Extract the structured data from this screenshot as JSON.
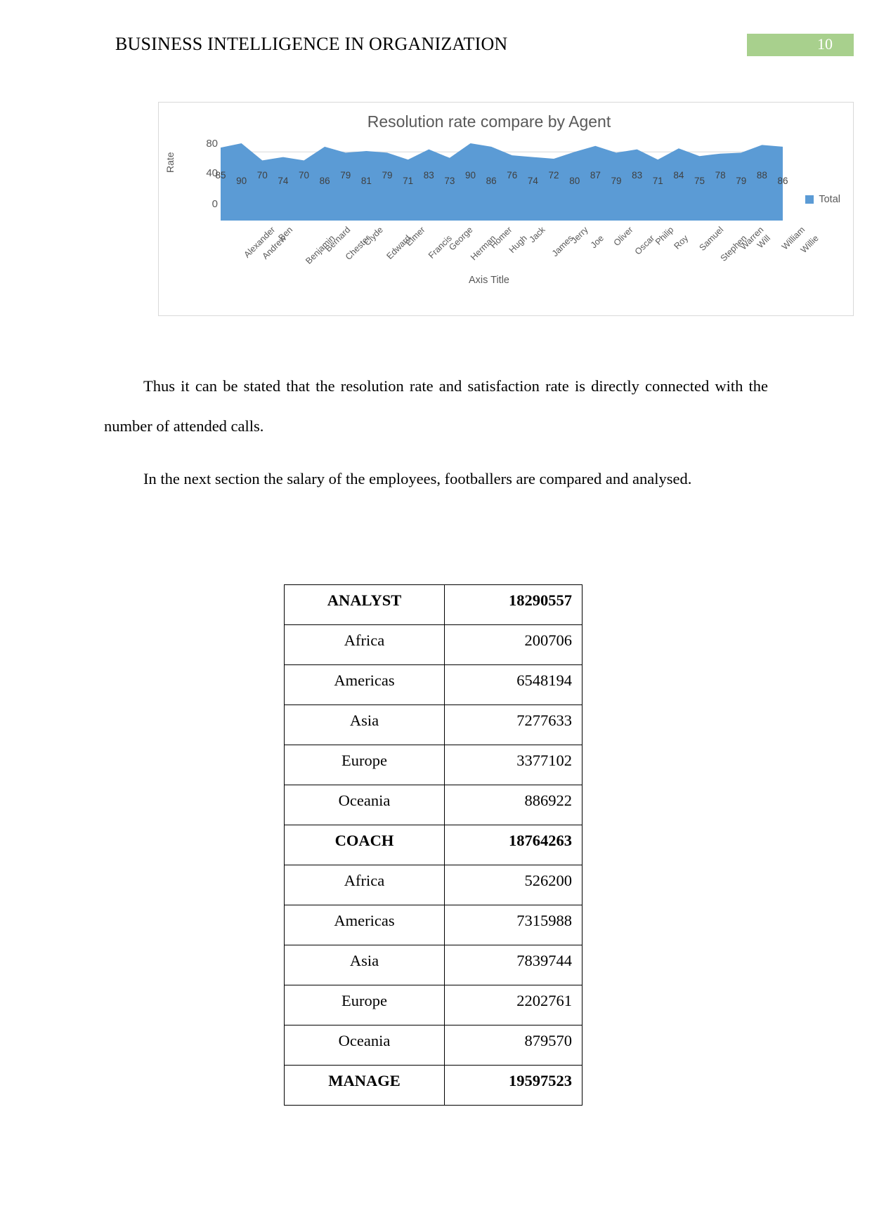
{
  "header": {
    "title": "BUSINESS INTELLIGENCE IN ORGANIZATION",
    "page_number": "10",
    "badge_color": "#a8d08d"
  },
  "chart_data": {
    "type": "area",
    "title": "Resolution rate compare by Agent",
    "xlabel": "Axis Title",
    "ylabel": "Rate",
    "legend": [
      "Total"
    ],
    "legend_position": "right",
    "series_color": "#5b9bd5",
    "ylim": [
      0,
      90
    ],
    "yticks": [
      "0",
      "40",
      "80"
    ],
    "grid": true,
    "categories": [
      "Alexander",
      "Andrew",
      "Ben",
      "Benjamin",
      "Bernard",
      "Chester",
      "Clyde",
      "Edward",
      "Elmer",
      "Francis",
      "George",
      "Herman",
      "Homer",
      "Hugh",
      "Jack",
      "James",
      "Jerry",
      "Joe",
      "Oliver",
      "Oscar",
      "Philip",
      "Roy",
      "Samuel",
      "Stephen",
      "Warren",
      "Will",
      "William",
      "Willie"
    ],
    "series": [
      {
        "name": "Total",
        "values": [
          85,
          90,
          70,
          74,
          70,
          86,
          79,
          81,
          79,
          71,
          83,
          73,
          90,
          86,
          76,
          74,
          72,
          80,
          87,
          79,
          83,
          71,
          84,
          75,
          78,
          79,
          88,
          86
        ]
      }
    ]
  },
  "body": {
    "paragraph_1": "Thus it can be stated that the resolution rate and satisfaction rate is directly connected with the number of attended calls.",
    "paragraph_2": "In the next section the salary of the employees, footballers are compared and analysed."
  },
  "table": {
    "rows": [
      {
        "label": "ANALYST",
        "value": "18290557",
        "group": true
      },
      {
        "label": "Africa",
        "value": "200706",
        "group": false
      },
      {
        "label": "Americas",
        "value": "6548194",
        "group": false
      },
      {
        "label": "Asia",
        "value": "7277633",
        "group": false
      },
      {
        "label": "Europe",
        "value": "3377102",
        "group": false
      },
      {
        "label": "Oceania",
        "value": "886922",
        "group": false
      },
      {
        "label": "COACH",
        "value": "18764263",
        "group": true
      },
      {
        "label": "Africa",
        "value": "526200",
        "group": false
      },
      {
        "label": "Americas",
        "value": "7315988",
        "group": false
      },
      {
        "label": "Asia",
        "value": "7839744",
        "group": false
      },
      {
        "label": "Europe",
        "value": "2202761",
        "group": false
      },
      {
        "label": "Oceania",
        "value": "879570",
        "group": false
      },
      {
        "label": "MANAGE",
        "value": "19597523",
        "group": true
      }
    ]
  }
}
